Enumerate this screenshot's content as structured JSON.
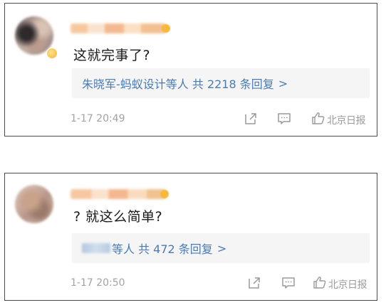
{
  "comments": [
    {
      "text": "这就完事了?",
      "reply_summary": "朱晓军-蚂蚁设计等人 共 2218 条回复",
      "reply_chevron": ">",
      "timestamp": "1-17 20:49",
      "watermark": "北京日报"
    },
    {
      "text": "? 就这么简单?",
      "reply_summary": "等人 共 472 条回复",
      "reply_chevron": ">",
      "timestamp": "1-17 20:50",
      "watermark": "北京日报"
    }
  ],
  "icons": {
    "share": "share-icon",
    "comment": "comment-icon",
    "like": "like-icon"
  },
  "colors": {
    "reply_link": "#4a7bb5",
    "timestamp": "#a3a3a3",
    "text": "#1a1a1a"
  }
}
